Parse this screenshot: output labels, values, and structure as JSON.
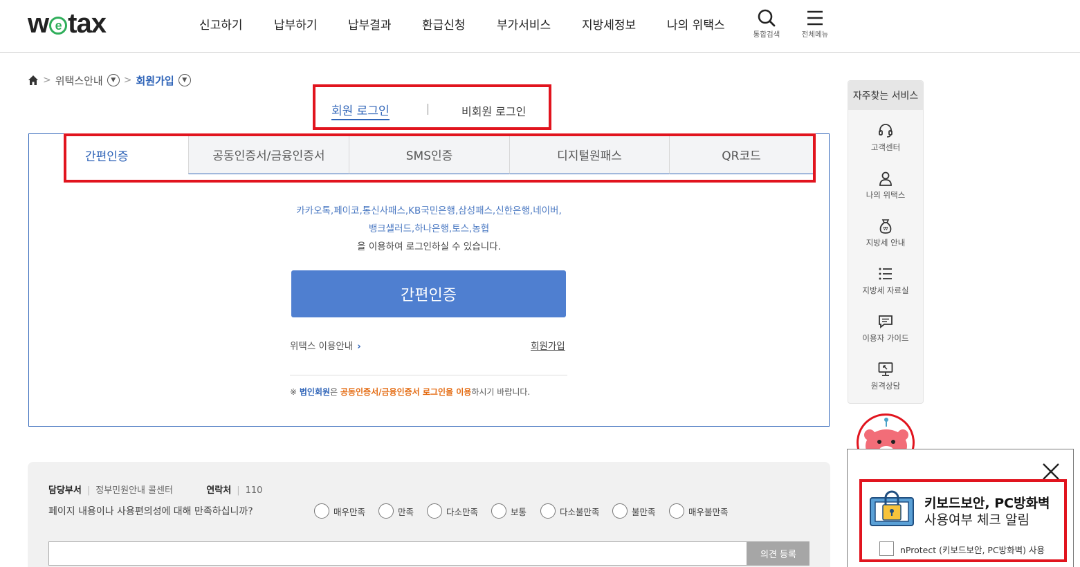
{
  "header": {
    "logo": "wetax",
    "nav": [
      "신고하기",
      "납부하기",
      "납부결과",
      "환급신청",
      "부가서비스",
      "지방세정보",
      "나의 위택스"
    ],
    "search_label": "통합검색",
    "menu_label": "전체메뉴"
  },
  "breadcrumb": {
    "level1": "위택스안내",
    "level2": "회원가입"
  },
  "login_type": {
    "member": "회원 로그인",
    "guest": "비회원 로그인"
  },
  "auth_tabs": [
    "간편인증",
    "공동인증서/금융인증서",
    "SMS인증",
    "디지털원패스",
    "QR코드"
  ],
  "simple_auth": {
    "providers_line1": "카카오톡,페이코,통신사패스,KB국민은행,삼성패스,신한은행,네이버,",
    "providers_line2": "뱅크샐러드,하나은행,토스,농협",
    "providers_tail": "을 이용하여 로그인하실 수 있습니다.",
    "button": "간편인증",
    "guide_link": "위택스 이용안내",
    "join_link": "회원가입",
    "notice_mark": "※",
    "notice_corp": "법인회원",
    "notice_mid": "은 ",
    "notice_cert": "공동인증서/금융인증서 로그인을 이용",
    "notice_end": "하시기 바랍니다."
  },
  "feedback": {
    "dept_label": "담당부서",
    "dept_value": "정부민원안내 콜센터",
    "contact_label": "연락처",
    "contact_value": "110",
    "question": "페이지 내용이나 사용편의성에 대해 만족하십니까?",
    "ratings": [
      "매우만족",
      "만족",
      "다소만족",
      "보통",
      "다소불만족",
      "불만족",
      "매우불만족"
    ],
    "submit": "의견 등록"
  },
  "quick_menu": {
    "title": "자주찾는 서비스",
    "items": [
      "고객센터",
      "나의 위택스",
      "지방세 안내",
      "지방세 자료실",
      "이용자 가이드",
      "원격상담"
    ]
  },
  "security_popup": {
    "title_line1": "키보드보안, PC방화벽",
    "title_line2": "사용여부 체크 알림",
    "checkbox_label": "nProtect (키보드보안, PC방화벽) 사용"
  },
  "colors": {
    "brand_blue": "#2f64b8",
    "button_blue": "#4f7fd0",
    "highlight_red": "#e1141e",
    "notice_orange": "#e46b12"
  }
}
